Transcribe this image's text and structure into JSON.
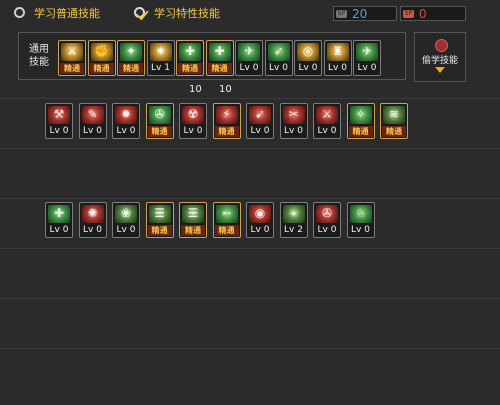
{
  "header": {
    "option_normal": "学习普通技能",
    "option_special": "学习特性技能",
    "counter_blue": {
      "tag": "SP",
      "value": "20",
      "color": "#4aa3e8"
    },
    "counter_red": {
      "tag": "SP",
      "value": "0",
      "color": "#e04a3a"
    }
  },
  "common_panel": {
    "label": "通用\n技能",
    "skills": [
      {
        "icon": "gold",
        "glyph": "⚔",
        "badge": "精通",
        "rare": true
      },
      {
        "icon": "gold",
        "glyph": "✊",
        "badge": "精通",
        "rare": true
      },
      {
        "icon": "green",
        "glyph": "✦",
        "badge": "精通",
        "rare": true
      },
      {
        "icon": "gold",
        "glyph": "✷",
        "badge": "Lv 1",
        "rare": false
      },
      {
        "icon": "green",
        "glyph": "✚",
        "badge": "精通",
        "rare": true
      },
      {
        "icon": "green",
        "glyph": "✚",
        "badge": "精通",
        "rare": true
      },
      {
        "icon": "green",
        "glyph": "✈",
        "badge": "Lv 0",
        "rare": false
      },
      {
        "icon": "green",
        "glyph": "➶",
        "badge": "Lv 0",
        "rare": false
      },
      {
        "icon": "gold",
        "glyph": "◎",
        "badge": "Lv 0",
        "rare": false
      },
      {
        "icon": "gold",
        "glyph": "♜",
        "badge": "Lv 0",
        "rare": false
      },
      {
        "icon": "green",
        "glyph": "✈",
        "badge": "Lv 0",
        "rare": false
      }
    ],
    "counts": [
      "10",
      "10"
    ]
  },
  "steal": {
    "label": "偷学技能",
    "icon": "red-orb-icon"
  },
  "row1": [
    {
      "icon": "red",
      "glyph": "⚒",
      "badge": "Lv 0",
      "rare": false
    },
    {
      "icon": "red",
      "glyph": "✎",
      "badge": "Lv 0",
      "rare": false
    },
    {
      "icon": "red",
      "glyph": "✹",
      "badge": "Lv 0",
      "rare": false
    },
    {
      "icon": "green",
      "glyph": "✇",
      "badge": "精通",
      "rare": true
    },
    {
      "icon": "red",
      "glyph": "☢",
      "badge": "Lv 0",
      "rare": false
    },
    {
      "icon": "red",
      "glyph": "⚡",
      "badge": "精通",
      "rare": true
    },
    {
      "icon": "red",
      "glyph": "➹",
      "badge": "Lv 0",
      "rare": false
    },
    {
      "icon": "red",
      "glyph": "✂",
      "badge": "Lv 0",
      "rare": false
    },
    {
      "icon": "red",
      "glyph": "⚔",
      "badge": "Lv 0",
      "rare": false
    },
    {
      "icon": "green",
      "glyph": "✧",
      "badge": "精通",
      "rare": true
    },
    {
      "icon": "teal",
      "glyph": "≋",
      "badge": "精通",
      "rare": true
    }
  ],
  "row2": [
    {
      "icon": "green",
      "glyph": "✚",
      "badge": "Lv 0",
      "rare": false
    },
    {
      "icon": "red",
      "glyph": "✺",
      "badge": "Lv 0",
      "rare": false
    },
    {
      "icon": "teal",
      "glyph": "❀",
      "badge": "Lv 0",
      "rare": false
    },
    {
      "icon": "teal",
      "glyph": "☰",
      "badge": "精通",
      "rare": true
    },
    {
      "icon": "teal",
      "glyph": "☰",
      "badge": "精通",
      "rare": true
    },
    {
      "icon": "green",
      "glyph": "➵",
      "badge": "精通",
      "rare": true
    },
    {
      "icon": "red",
      "glyph": "◉",
      "badge": "Lv 0",
      "rare": false
    },
    {
      "icon": "teal",
      "glyph": "⌖",
      "badge": "Lv 2",
      "rare": false
    },
    {
      "icon": "red",
      "glyph": "✇",
      "badge": "Lv 0",
      "rare": false
    },
    {
      "icon": "green",
      "glyph": "♘",
      "badge": "Lv 0",
      "rare": false
    }
  ]
}
